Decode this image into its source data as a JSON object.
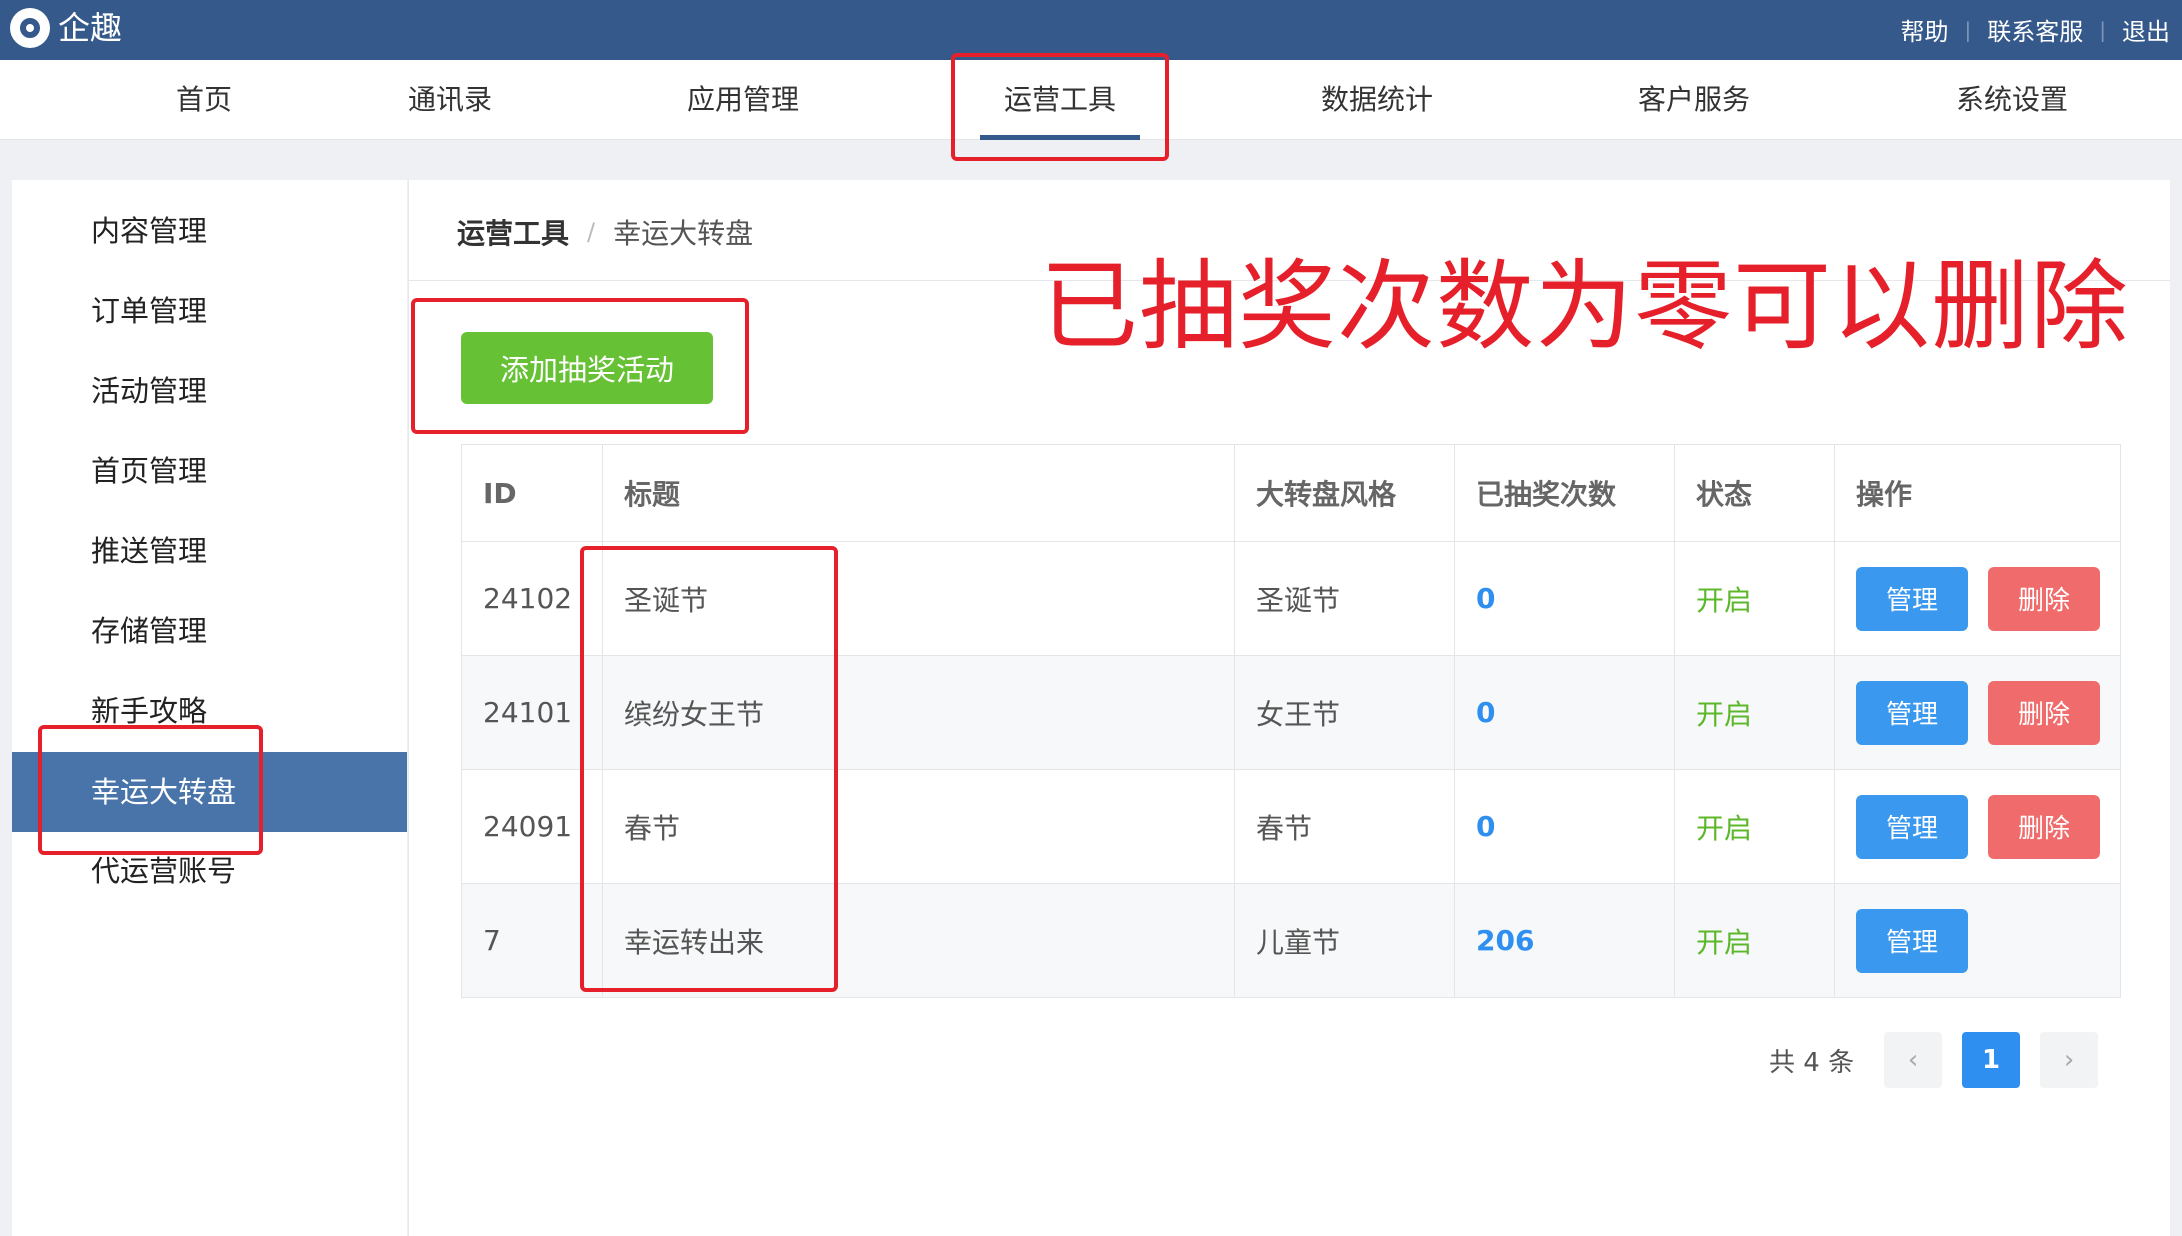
{
  "topbar": {
    "brand": "企趣",
    "links": [
      "帮助",
      "联系客服",
      "退出"
    ],
    "separator": "|"
  },
  "nav": {
    "items": [
      "首页",
      "通讯录",
      "应用管理",
      "运营工具",
      "数据统计",
      "客户服务",
      "系统设置"
    ],
    "active": "运营工具"
  },
  "sidebar": {
    "items": [
      "内容管理",
      "订单管理",
      "活动管理",
      "首页管理",
      "推送管理",
      "存储管理",
      "新手攻略",
      "幸运大转盘",
      "代运营账号"
    ],
    "active": "幸运大转盘"
  },
  "breadcrumb": {
    "root": "运营工具",
    "separator": "/",
    "current": "幸运大转盘"
  },
  "add_button": "添加抽奖活动",
  "table": {
    "columns": [
      "ID",
      "标题",
      "大转盘风格",
      "已抽奖次数",
      "状态",
      "操作"
    ],
    "rows": [
      {
        "id": "24102",
        "title": "圣诞节",
        "style": "圣诞节",
        "count": "0",
        "status": "开启",
        "manage": "管理",
        "delete": "删除"
      },
      {
        "id": "24101",
        "title": "缤纷女王节",
        "style": "女王节",
        "count": "0",
        "status": "开启",
        "manage": "管理",
        "delete": "删除"
      },
      {
        "id": "24091",
        "title": "春节",
        "style": "春节",
        "count": "0",
        "status": "开启",
        "manage": "管理",
        "delete": "删除"
      },
      {
        "id": "7",
        "title": "幸运转出来",
        "style": "儿童节",
        "count": "206",
        "status": "开启",
        "manage": "管理"
      }
    ]
  },
  "pagination": {
    "total": "共 4 条",
    "prev": "‹",
    "current": "1",
    "next": "›"
  },
  "annotation": {
    "text": "已抽奖次数为零可以删除",
    "color": "#e6202b"
  },
  "colors": {
    "topbar": "#34598a",
    "sidebar_active": "#4874aa",
    "add_button": "#66c135",
    "manage_button": "#3a98ee",
    "delete_button": "#f06c6c",
    "status_on": "#5cb82a",
    "count": "#2e8ff0"
  }
}
